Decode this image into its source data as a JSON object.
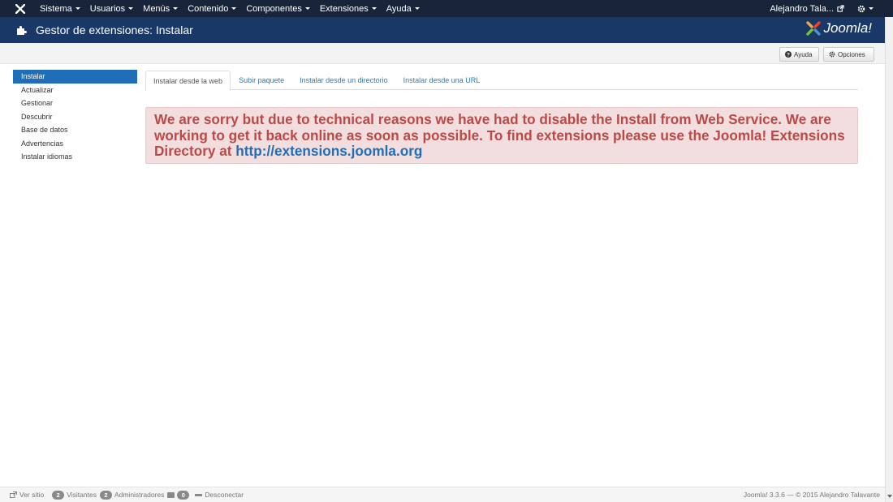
{
  "navbar": {
    "menu": [
      "Sistema",
      "Usuarios",
      "Menús",
      "Contenido",
      "Componentes",
      "Extensiones",
      "Ayuda"
    ],
    "user_name": "Alejandro Tala..."
  },
  "header": {
    "title": "Gestor de extensiones: Instalar",
    "brand": "Joomla!"
  },
  "toolbar": {
    "help_label": "Ayuda",
    "options_label": "Opciones"
  },
  "sidebar": {
    "items": [
      {
        "label": "Instalar",
        "active": true
      },
      {
        "label": "Actualizar"
      },
      {
        "label": "Gestionar"
      },
      {
        "label": "Descubrir"
      },
      {
        "label": "Base de datos"
      },
      {
        "label": "Advertencias"
      },
      {
        "label": "Instalar idiomas"
      }
    ]
  },
  "tabs": [
    {
      "label": "Instalar desde la web",
      "active": true
    },
    {
      "label": "Subir paquete"
    },
    {
      "label": "Instalar desde un directorio"
    },
    {
      "label": "Instalar desde una URL"
    }
  ],
  "alert": {
    "text": "We are sorry but due to technical reasons we have had to disable the Install from Web Service. We are working to get it back online as soon as possible. To find extensions please use the Joomla! Extensions Directory at ",
    "link": "http://extensions.joomla.org"
  },
  "status": {
    "view_site": "Ver sitio",
    "visitors_count": "2",
    "visitors_label": "Visitantes",
    "admins_count": "2",
    "admins_label": "Administradores",
    "messages_count": "0",
    "logout_label": "Desconectar",
    "version": "Joomla! 3.3.6  —  © 2015 Alejandro Talavante"
  },
  "colors": {
    "navbar": "#17243a",
    "header": "#1a3867",
    "accent": "#1f6eb7",
    "alert_bg": "#f2dede",
    "alert_text": "#b94a48"
  }
}
